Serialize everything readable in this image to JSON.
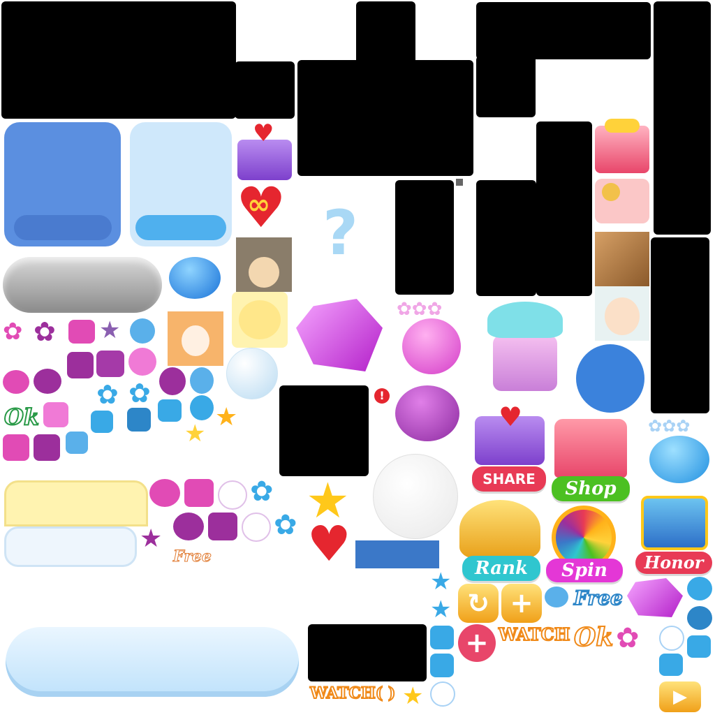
{
  "labels": {
    "share": "SHARE",
    "shop": "Shop",
    "rank": "Rank",
    "spin": "Spin",
    "honor": "Honor",
    "free_small": "Free",
    "free_blue": "Free",
    "ok_green": "Ok",
    "ok_orange": "Ok",
    "watch_orange": "WATCH",
    "watch_bottom": "WATCH(   )",
    "question_mark": "?",
    "infinity": "∞",
    "alert": "!",
    "plus": "+",
    "plus_pink": "+",
    "play": "▶",
    "retry": "↻"
  },
  "colors": {
    "blue_panel": "#5b8fe0",
    "light_blue_panel": "#cfe8fb",
    "gray_pill": "#a9a9a9",
    "pink": "#e14bb5",
    "purple": "#9c2f9c",
    "cyan": "#39a9e6",
    "yellow": "#ffd23a",
    "orange": "#ff9f1a",
    "red": "#e5262f",
    "green_badge": "#4cc022",
    "magenta_badge": "#e437d6",
    "teal_badge": "#2fc6cf",
    "red_badge": "#e83a55"
  },
  "icons": [
    "gift-box-icon",
    "heart-infinity-icon",
    "question-icon",
    "soldier-avatar-icon",
    "dog-avatar-icon",
    "boy-avatar-icon",
    "cat-photo-icon",
    "glasses-avatar-icon",
    "gem-icon",
    "button-pink-icon",
    "button-purple-icon",
    "button-blue-icon",
    "cake-bow-icon",
    "trophy-icon",
    "wheel-icon",
    "chest-icon",
    "shop-icon",
    "star-icon",
    "heart-icon",
    "bubble-icon",
    "paw-icon",
    "flower-icon"
  ]
}
